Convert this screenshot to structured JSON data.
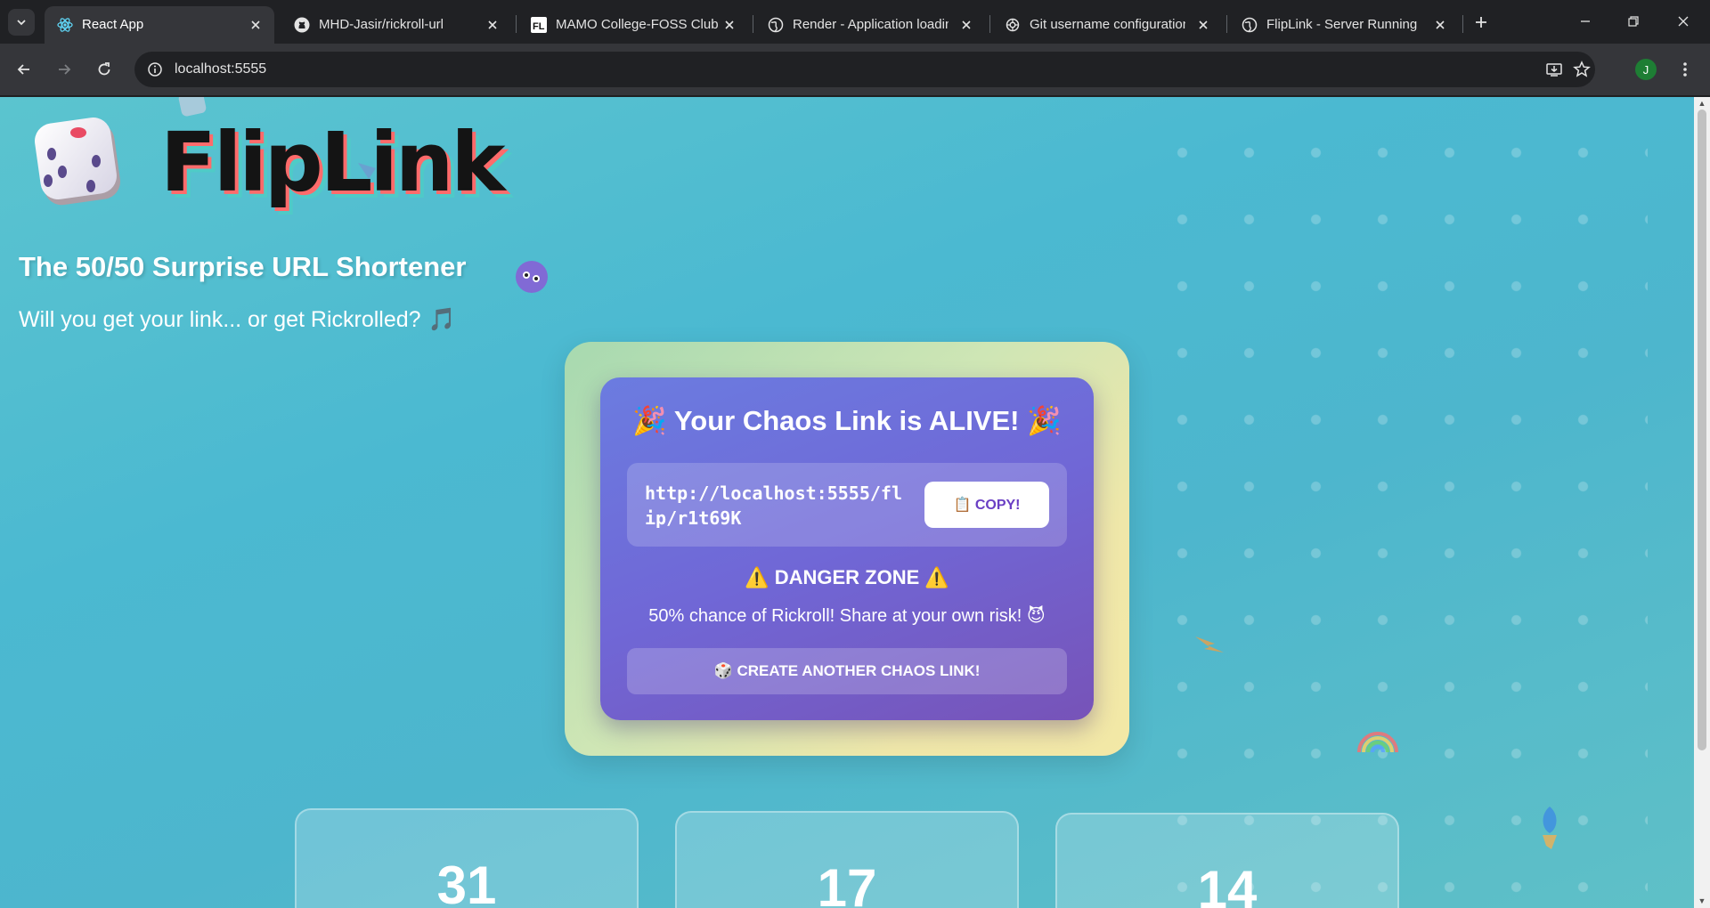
{
  "browser": {
    "tabs": [
      {
        "title": "React App",
        "favicon": "react-icon",
        "active": true
      },
      {
        "title": "MHD-Jasir/rickroll-url",
        "favicon": "github-icon",
        "active": false
      },
      {
        "title": "MAMO College-FOSS Club",
        "favicon": "foss-club-icon",
        "active": false
      },
      {
        "title": "Render - Application loadin",
        "favicon": "globe-icon",
        "active": false
      },
      {
        "title": "Git username configuration",
        "favicon": "chatgpt-icon",
        "active": false
      },
      {
        "title": "FlipLink - Server Running",
        "favicon": "globe-icon",
        "active": false
      }
    ],
    "address": "localhost:5555",
    "profile_initial": "J"
  },
  "header": {
    "logo_text": "FlipLink",
    "subtitle": "The 50/50 Surprise URL Shortener",
    "tagline": "Will you get your link... or get Rickrolled?",
    "tagline_emoji": "🎵"
  },
  "result_card": {
    "title": "🎉 Your Chaos Link is ALIVE! 🎉",
    "short_url": "http://localhost:5555/flip/r1t69K",
    "copy_label": "📋 COPY!",
    "danger_title": "⚠️ DANGER ZONE ⚠️",
    "danger_text": "50% chance of Rickroll! Share at your own risk! 😈",
    "create_label": "🎲 CREATE ANOTHER CHAOS LINK!"
  },
  "stats": [
    {
      "value": "31"
    },
    {
      "value": "17"
    },
    {
      "value": "14"
    }
  ],
  "colors": {
    "page_background": "#4bb9d1",
    "card_gradient_start": "#6b7ce0",
    "card_gradient_end": "#7753b8",
    "copy_text": "#6a3fc4"
  }
}
